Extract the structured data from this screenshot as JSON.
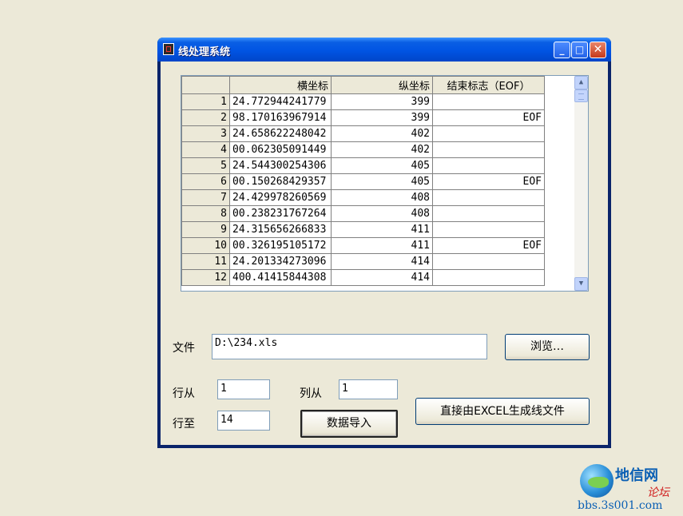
{
  "window": {
    "title": "线处理系统",
    "minimize_glyph": "_",
    "maximize_glyph": "□",
    "close_glyph": "✕"
  },
  "grid": {
    "columns": [
      "",
      "横坐标",
      "纵坐标",
      "结束标志（EOF）"
    ],
    "rows": [
      {
        "index": "1",
        "x": "24.772944241779",
        "y": "399",
        "eof": ""
      },
      {
        "index": "2",
        "x": "98.170163967914",
        "y": "399",
        "eof": "EOF"
      },
      {
        "index": "3",
        "x": "24.658622248042",
        "y": "402",
        "eof": ""
      },
      {
        "index": "4",
        "x": "00.062305091449",
        "y": "402",
        "eof": ""
      },
      {
        "index": "5",
        "x": "24.544300254306",
        "y": "405",
        "eof": ""
      },
      {
        "index": "6",
        "x": "00.150268429357",
        "y": "405",
        "eof": "EOF"
      },
      {
        "index": "7",
        "x": "24.429978260569",
        "y": "408",
        "eof": ""
      },
      {
        "index": "8",
        "x": "00.238231767264",
        "y": "408",
        "eof": ""
      },
      {
        "index": "9",
        "x": "24.315656266833",
        "y": "411",
        "eof": ""
      },
      {
        "index": "10",
        "x": "00.326195105172",
        "y": "411",
        "eof": "EOF"
      },
      {
        "index": "11",
        "x": "24.201334273096",
        "y": "414",
        "eof": ""
      },
      {
        "index": "12",
        "x": "400.41415844308",
        "y": "414",
        "eof": ""
      }
    ]
  },
  "file": {
    "label": "文件",
    "value": "D:\\234.xls",
    "browse_label": "浏览…"
  },
  "range": {
    "row_from_label": "行从",
    "row_from_value": "1",
    "row_to_label": "行至",
    "row_to_value": "14",
    "col_from_label": "列从",
    "col_from_value": "1"
  },
  "actions": {
    "import_label": "数据导入",
    "excel_label": "直接由EXCEL生成线文件"
  },
  "watermark": {
    "name": "地信网",
    "sub": "论坛",
    "url": "bbs.3s001.com"
  }
}
